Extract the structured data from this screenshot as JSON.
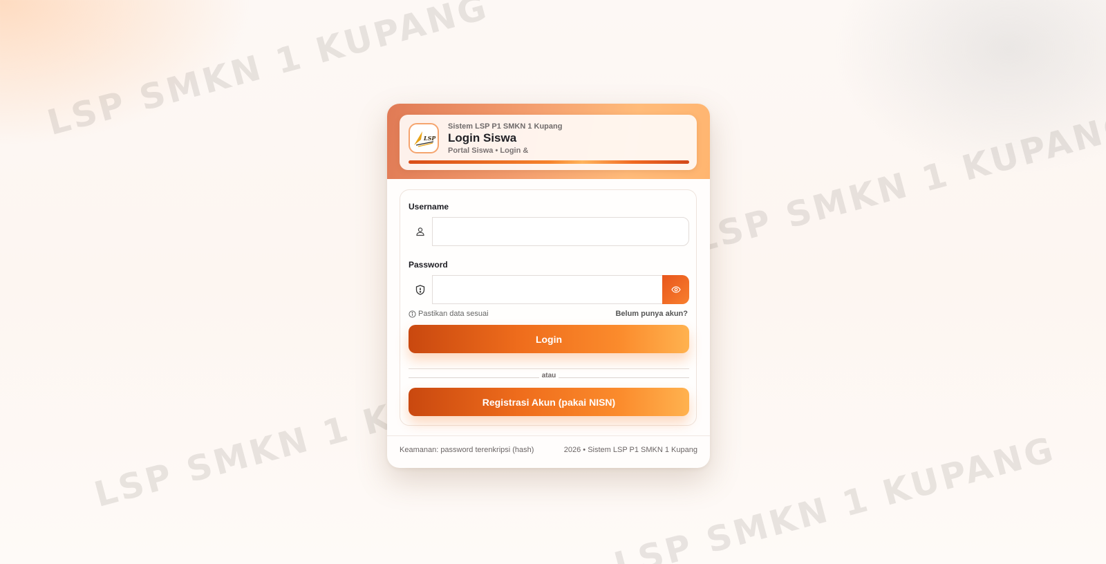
{
  "watermark": {
    "text": "LSP SMKN 1 KUPANG"
  },
  "header": {
    "kicker": "Sistem LSP P1 SMKN 1 Kupang",
    "title": "Login Siswa",
    "subtitle": "Portal Siswa • Login &",
    "logo_text": "LSP"
  },
  "form": {
    "username_label": "Username",
    "username_value": "",
    "password_label": "Password",
    "password_value": "",
    "hint_text": "Pastikan data sesuai",
    "no_account_link": "Belum punya akun?",
    "login_button": "Login",
    "divider_text": "atau",
    "register_button": "Registrasi Akun (pakai NISN)"
  },
  "footer": {
    "security_note": "Keamanan: password terenkripsi (hash)",
    "copyright": "2026 • Sistem LSP P1 SMKN 1 Kupang"
  },
  "icons": {
    "username": "user-icon",
    "password": "shield-icon",
    "toggle": "eye-icon",
    "hint": "info-icon"
  },
  "colors": {
    "accent": "#f5822c",
    "accent_dark": "#c9480f",
    "accent_light": "#ffb24f"
  }
}
